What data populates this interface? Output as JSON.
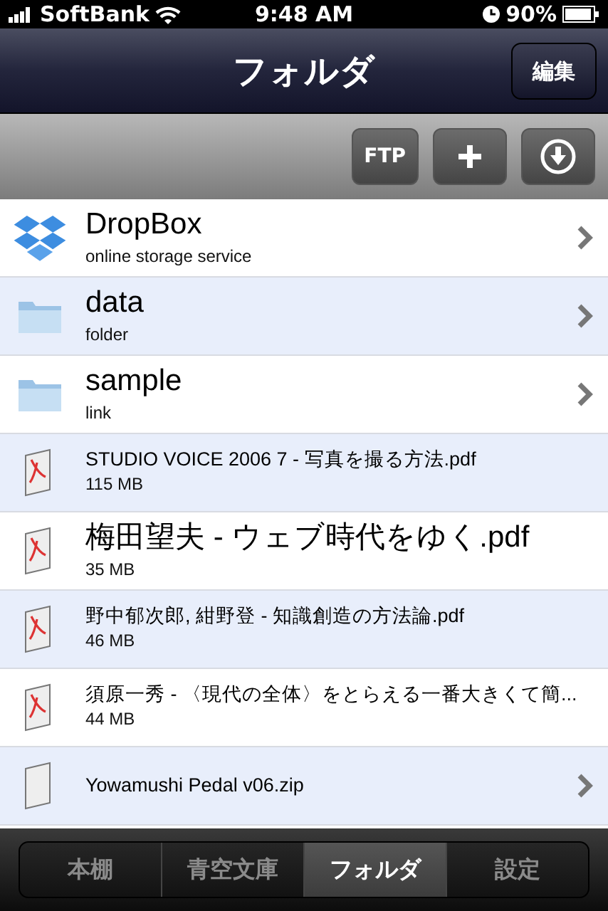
{
  "status_bar": {
    "carrier": "SoftBank",
    "time": "9:48 AM",
    "battery": "90%"
  },
  "nav_bar": {
    "title": "フォルダ",
    "edit_button": "編集"
  },
  "toolbar": {
    "buttons": [
      {
        "kind": "text",
        "label": "FTP"
      },
      {
        "kind": "add"
      },
      {
        "kind": "download"
      }
    ]
  },
  "items": [
    {
      "kind": "dropbox",
      "title": "DropBox",
      "subtitle": "online storage service"
    },
    {
      "kind": "folder",
      "title": "data",
      "subtitle": "folder"
    },
    {
      "kind": "folder",
      "title": "sample",
      "subtitle": "link"
    },
    {
      "kind": "pdf",
      "title": "STUDIO VOICE 2006 7 - 写真を撮る方法.pdf",
      "subtitle": "115 MB"
    },
    {
      "kind": "pdf",
      "title": "梅田望夫 - ウェブ時代をゆく.pdf",
      "subtitle": "35 MB"
    },
    {
      "kind": "pdf",
      "title": "野中郁次郎, 紺野登 - 知識創造の方法論.pdf",
      "subtitle": "46 MB"
    },
    {
      "kind": "pdf",
      "title": "須原一秀 - 〈現代の全体〉をとらえる一番大きくて簡...",
      "subtitle": "44 MB"
    },
    {
      "kind": "zip",
      "title": "Yowamushi Pedal v06.zip"
    }
  ],
  "tab_bar": [
    {
      "label": "本棚",
      "selected": false
    },
    {
      "label": "青空文庫",
      "selected": false
    },
    {
      "label": "フォルダ",
      "selected": true
    },
    {
      "label": "設定",
      "selected": false
    }
  ]
}
